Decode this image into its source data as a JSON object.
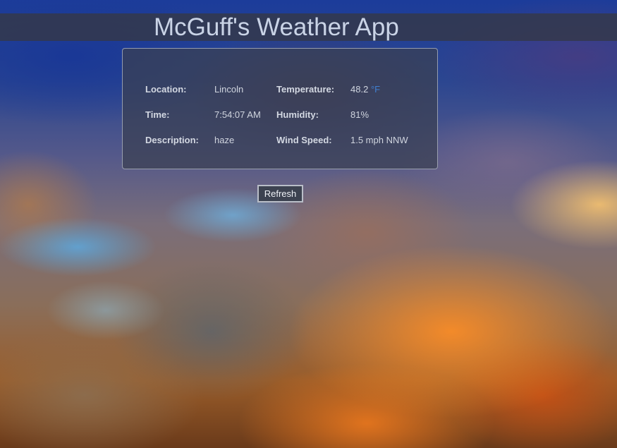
{
  "app": {
    "title": "McGuff's Weather App"
  },
  "weather": {
    "location_label": "Location:",
    "location_value": "Lincoln",
    "time_label": "Time:",
    "time_value": "7:54:07 AM",
    "description_label": "Description:",
    "description_value": "haze",
    "temperature_label": "Temperature:",
    "temperature_value": "48.2",
    "temperature_unit": "°F",
    "humidity_label": "Humidity:",
    "humidity_value": "81%",
    "wind_label": "Wind Speed:",
    "wind_value": "1.5 mph NNW"
  },
  "actions": {
    "refresh_label": "Refresh"
  },
  "colors": {
    "header_bar": "#343848",
    "title_text": "#c9d3e6",
    "card_background": "#3a4052",
    "unit_accent": "#3f7fd0",
    "button_background": "#3c4250"
  }
}
